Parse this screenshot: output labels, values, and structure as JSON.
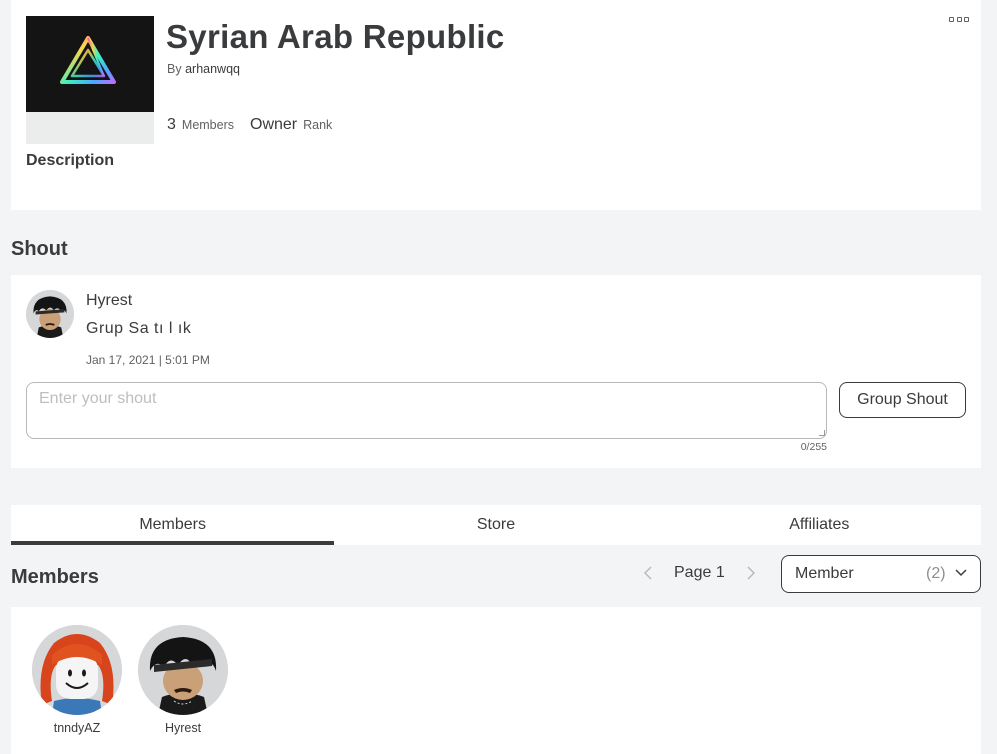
{
  "group": {
    "name": "Syrian Arab Republic",
    "by_prefix": "By",
    "owner": "arhanwqq",
    "member_count": "3",
    "member_count_label": "Members",
    "rank": "Owner",
    "rank_label": "Rank",
    "description_heading": "Description"
  },
  "shout": {
    "heading": "Shout",
    "poster": "Hyrest",
    "body": "Grup Sa tı l ık",
    "date": "Jan 17, 2021 | 5:01 PM",
    "input_placeholder": "Enter your shout",
    "counter": "0/255",
    "button_label": "Group Shout"
  },
  "tabs": [
    {
      "label": "Members",
      "active": true
    },
    {
      "label": "Store",
      "active": false
    },
    {
      "label": "Affiliates",
      "active": false
    }
  ],
  "members": {
    "heading": "Members",
    "page_label": "Page 1",
    "role_select": {
      "label": "Member",
      "count": "(2)"
    },
    "list": [
      {
        "name": "tnndyAZ",
        "avatar": "avatar-orange-hair"
      },
      {
        "name": "Hyrest",
        "avatar": "avatar-black-hair"
      }
    ]
  },
  "icons": {
    "more": "more-options-icon",
    "prev": "chevron-left-icon",
    "next": "chevron-right-icon",
    "dropdown": "chevron-down-icon"
  },
  "colors": {
    "page_background": "#f2f4f5",
    "card_background": "#ffffff",
    "text_primary": "#393b3d",
    "text_secondary": "#606162"
  }
}
